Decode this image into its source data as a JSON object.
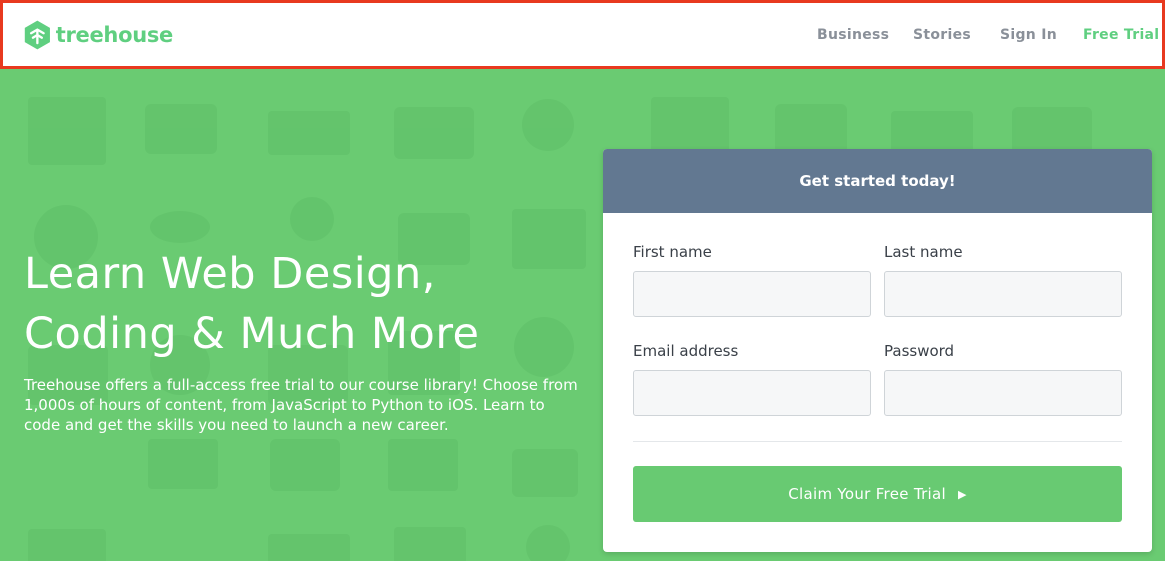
{
  "header": {
    "logo_text": "treehouse",
    "nav": {
      "business": "Business",
      "stories": "Stories",
      "sign_in": "Sign In",
      "free_trial": "Free Trial"
    }
  },
  "hero": {
    "title_line1": "Learn Web Design,",
    "title_line2": "Coding & Much More",
    "description": "Treehouse offers a full-access free trial to our course library! Choose from 1,000s of hours of content, from JavaScript to Python to iOS. Learn to code and get the skills you need to launch a new career."
  },
  "form": {
    "heading": "Get started today!",
    "first_name_label": "First name",
    "last_name_label": "Last name",
    "email_label": "Email address",
    "password_label": "Password",
    "first_name_value": "",
    "last_name_value": "",
    "email_value": "",
    "password_value": "",
    "submit_label": "Claim Your Free Trial",
    "submit_icon": "play-triangle-icon"
  },
  "colors": {
    "brand_green": "#5fcf80",
    "hero_bg": "#6acb72",
    "form_header": "#627891",
    "cta_green": "#68ca72",
    "header_border": "#e8391f"
  }
}
